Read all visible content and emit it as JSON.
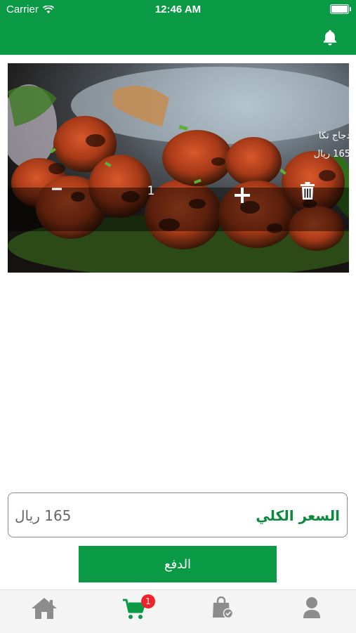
{
  "status_bar": {
    "carrier": "Carrier",
    "time": "12:46 AM"
  },
  "colors": {
    "brand_green": "#0a9a45",
    "badge_red": "#f0232b"
  },
  "cart": {
    "items": [
      {
        "name": "دجاج تكا",
        "price": "165 ريال",
        "quantity": "1",
        "image": "tikka-chicken-photo"
      }
    ]
  },
  "total": {
    "label": "السعر الكلي",
    "value": "165 ريال"
  },
  "pay_button": {
    "label": "الدفع"
  },
  "tabs": [
    {
      "name": "home",
      "icon": "home-icon"
    },
    {
      "name": "cart",
      "icon": "cart-icon",
      "badge": "1",
      "active": true
    },
    {
      "name": "orders",
      "icon": "shopping-bag-check-icon"
    },
    {
      "name": "profile",
      "icon": "user-icon"
    }
  ]
}
